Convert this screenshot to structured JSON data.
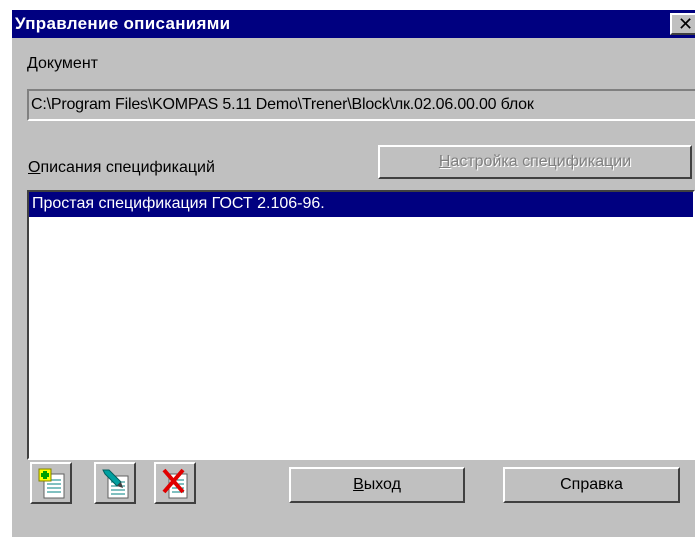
{
  "window": {
    "title": "Управление описаниями",
    "close_glyph": "✕"
  },
  "document": {
    "label": "Документ",
    "path": "C:\\Program Files\\KOMPAS 5.11 Demo\\Trener\\Block\\лк.02.06.00.00 блок"
  },
  "descriptions": {
    "label": "Описания спецификаций",
    "settings_button": "Настройка спецификации",
    "items": [
      "Простая спецификация ГОСТ 2.106-96."
    ]
  },
  "toolbar": {
    "add_icon": "add-description-icon",
    "edit_icon": "edit-description-icon",
    "delete_icon": "delete-description-icon"
  },
  "buttons": {
    "exit": "Выход",
    "help": "Справка"
  },
  "colors": {
    "titlebar": "#000080",
    "face": "#c0c0c0",
    "selection": "#000080"
  }
}
